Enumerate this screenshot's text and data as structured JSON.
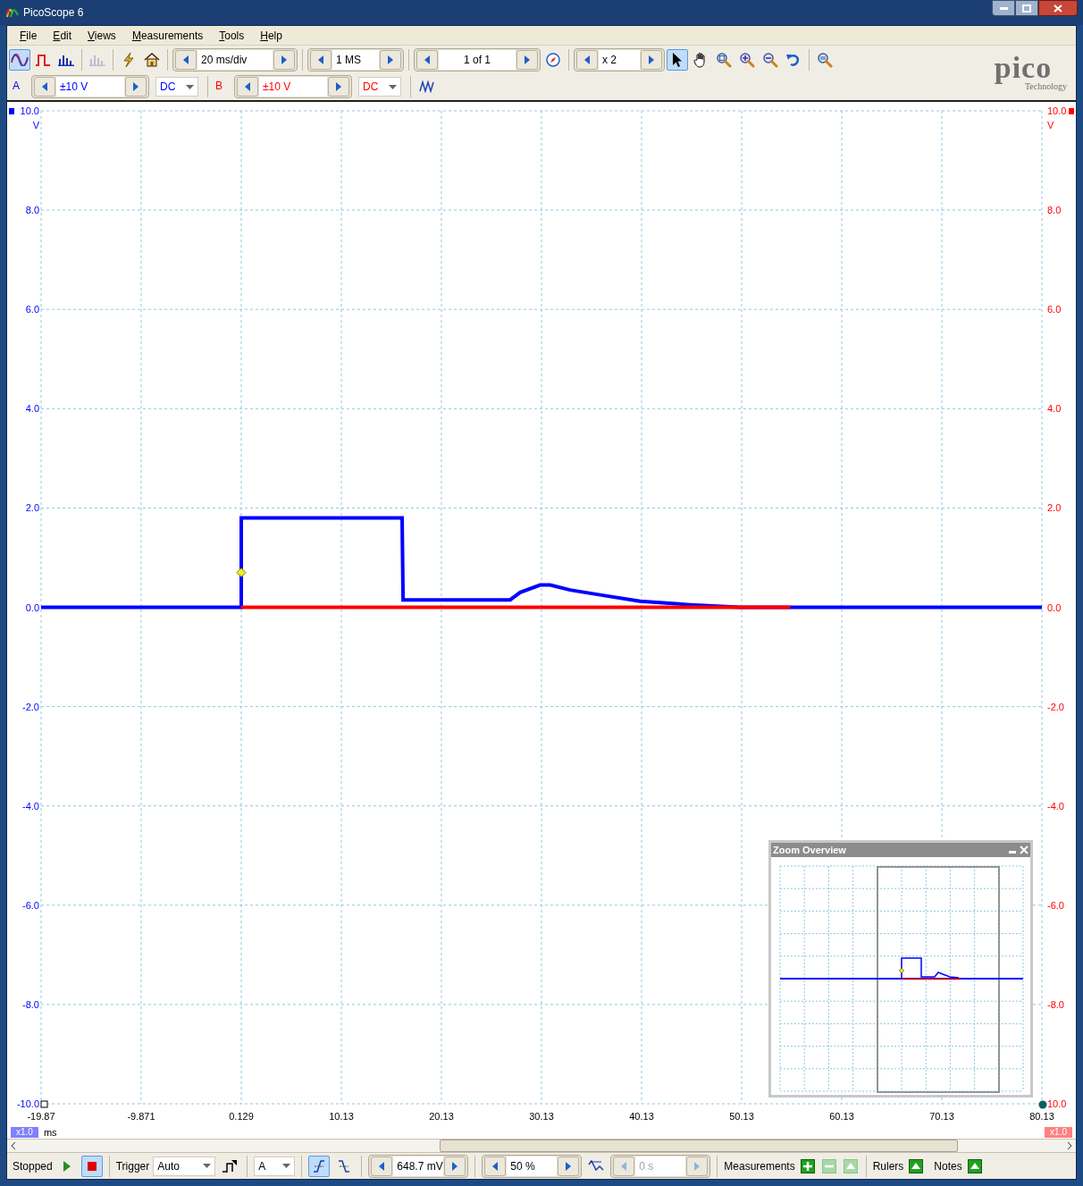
{
  "window": {
    "title": "PicoScope 6"
  },
  "menu": [
    {
      "label": "File"
    },
    {
      "label": "Edit"
    },
    {
      "label": "Views"
    },
    {
      "label": "Measurements"
    },
    {
      "label": "Tools"
    },
    {
      "label": "Help"
    }
  ],
  "mode_buttons": [
    {
      "kind": "scope",
      "selected": true,
      "disabled": false
    },
    {
      "kind": "persistence",
      "selected": false,
      "disabled": false
    },
    {
      "kind": "spectrum",
      "selected": false,
      "disabled": false
    },
    {
      "kind": "spectrum-options",
      "selected": false,
      "disabled": true
    }
  ],
  "timebase": "20 ms/div",
  "samples": "1 MS",
  "buffer": "1 of 1",
  "zoom": "x 2",
  "tools": [
    {
      "kind": "pointer",
      "selected": true
    },
    {
      "kind": "hand",
      "selected": false
    },
    {
      "kind": "zoom-region",
      "selected": false
    },
    {
      "kind": "zoom-in",
      "selected": false
    },
    {
      "kind": "zoom-out",
      "selected": false
    },
    {
      "kind": "undo",
      "selected": false
    },
    {
      "kind": "zoom-overview",
      "selected": false
    }
  ],
  "logo": {
    "name": "pico",
    "tagline": "Technology"
  },
  "channels": [
    {
      "label": "A",
      "range": "±10 V",
      "coupling": "DC",
      "color": "#0000ff"
    },
    {
      "label": "B",
      "range": "±10 V",
      "coupling": "DC",
      "color": "#ff0000"
    }
  ],
  "plot": {
    "left_unit": "V",
    "right_unit": "V",
    "x_unit": "ms",
    "left_scale": "x1.0",
    "right_scale": "x1.0",
    "right_ticks": [
      "10.0",
      "8.0",
      "6.0",
      "4.0",
      "2.0",
      "0.0",
      "-2.0",
      "-4.0",
      "-6.0",
      "-8.0",
      "10.0"
    ],
    "chart_data": {
      "type": "line",
      "grid": true,
      "xlim": [
        -19.87,
        80.13
      ],
      "ylim": [
        -10,
        10
      ],
      "x": [
        -19.87,
        0.129,
        0.13,
        16.2,
        16.3,
        27,
        28,
        30,
        31,
        33,
        36,
        40,
        45,
        50,
        55,
        80.13
      ],
      "series": [
        {
          "color": "#0000ff",
          "values": [
            0,
            0,
            1.8,
            1.8,
            0.15,
            0.15,
            0.3,
            0.45,
            0.45,
            0.35,
            0.25,
            0.12,
            0.05,
            0,
            0,
            0
          ]
        },
        {
          "color": "#ff0000",
          "values": [
            null,
            0,
            0,
            0,
            0,
            0,
            0,
            0,
            0,
            0,
            0,
            0,
            0,
            0,
            0,
            null
          ]
        }
      ],
      "xticks": [
        {
          "value": -19.87,
          "label": "-19.87"
        },
        {
          "value": -9.871,
          "label": "-9.871"
        },
        {
          "value": 0.129,
          "label": "0.129"
        },
        {
          "value": 10.13,
          "label": "10.13"
        },
        {
          "value": 20.13,
          "label": "20.13"
        },
        {
          "value": 30.13,
          "label": "30.13"
        },
        {
          "value": 40.13,
          "label": "40.13"
        },
        {
          "value": 50.13,
          "label": "50.13"
        },
        {
          "value": 60.13,
          "label": "60.13"
        },
        {
          "value": 70.13,
          "label": "70.13"
        },
        {
          "value": 80.13,
          "label": "80.13"
        }
      ],
      "yticks": [
        {
          "value": 10,
          "label": "10.0"
        },
        {
          "value": 8,
          "label": "8.0"
        },
        {
          "value": 6,
          "label": "6.0"
        },
        {
          "value": 4,
          "label": "4.0"
        },
        {
          "value": 2,
          "label": "2.0"
        },
        {
          "value": 0,
          "label": "0.0"
        },
        {
          "value": -2,
          "label": "-2.0"
        },
        {
          "value": -4,
          "label": "-4.0"
        },
        {
          "value": -6,
          "label": "-6.0"
        },
        {
          "value": -8,
          "label": "-8.0"
        },
        {
          "value": -10,
          "label": "-10.0"
        }
      ]
    }
  },
  "zoom_overview": {
    "title": "Zoom Overview"
  },
  "status": {
    "state": "Stopped",
    "run_selected": false,
    "stop_selected": true,
    "trigger_label": "Trigger",
    "trigger_mode": "Auto",
    "trigger_source": "A",
    "rising_selected": true,
    "falling_selected": false,
    "threshold": "648.7 mV",
    "pretrigger": "50 %",
    "delay": {
      "value": "0 s",
      "disabled": true
    },
    "measurements_label": "Measurements",
    "measurement_buttons": [
      {
        "kind": "add",
        "disabled": false
      },
      {
        "kind": "remove",
        "disabled": true
      },
      {
        "kind": "edit",
        "disabled": true
      }
    ],
    "rulers": "Rulers",
    "notes": "Notes"
  }
}
